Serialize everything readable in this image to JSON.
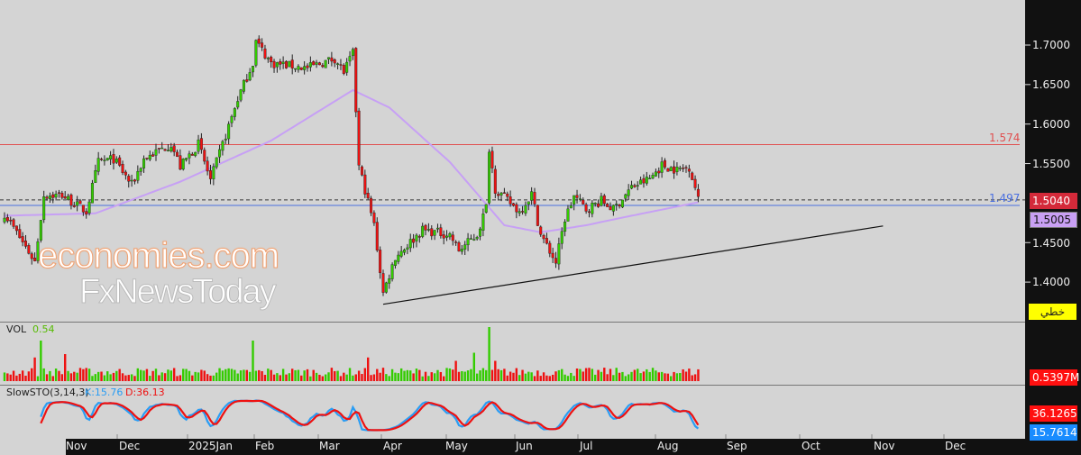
{
  "chart_data": {
    "type": "candlestick",
    "symbol_note": "daily price chart",
    "price_axis": {
      "ticks": [
        "1.7000",
        "1.6500",
        "1.6000",
        "1.5500",
        "1.4500",
        "1.4000"
      ],
      "ylim": [
        1.355,
        1.757
      ]
    },
    "x_axis": {
      "labels": [
        "Nov",
        "Dec",
        "2025Jan",
        "Feb",
        "Mar",
        "Apr",
        "May",
        "Jun",
        "Jul",
        "Aug",
        "Sep",
        "Oct",
        "Nov",
        "Dec"
      ]
    },
    "candle_count": 230,
    "close_keypoints": [
      [
        0,
        1.487
      ],
      [
        10,
        1.426
      ],
      [
        13,
        1.51
      ],
      [
        19,
        1.51
      ],
      [
        27,
        1.489
      ],
      [
        31,
        1.552
      ],
      [
        36,
        1.556
      ],
      [
        42,
        1.523
      ],
      [
        46,
        1.556
      ],
      [
        55,
        1.575
      ],
      [
        58,
        1.546
      ],
      [
        64,
        1.575
      ],
      [
        68,
        1.529
      ],
      [
        73,
        1.586
      ],
      [
        77,
        1.632
      ],
      [
        82,
        1.678
      ],
      [
        83,
        1.705
      ],
      [
        88,
        1.677
      ],
      [
        100,
        1.671
      ],
      [
        109,
        1.683
      ],
      [
        112,
        1.666
      ],
      [
        115,
        1.689
      ],
      [
        117,
        1.546
      ],
      [
        119,
        1.517
      ],
      [
        122,
        1.472
      ],
      [
        125,
        1.386
      ],
      [
        129,
        1.432
      ],
      [
        138,
        1.466
      ],
      [
        147,
        1.46
      ],
      [
        150,
        1.44
      ],
      [
        156,
        1.46
      ],
      [
        159,
        1.495
      ],
      [
        160,
        1.57
      ],
      [
        162,
        1.518
      ],
      [
        170,
        1.489
      ],
      [
        174,
        1.512
      ],
      [
        177,
        1.46
      ],
      [
        182,
        1.425
      ],
      [
        185,
        1.48
      ],
      [
        188,
        1.509
      ],
      [
        192,
        1.492
      ],
      [
        197,
        1.503
      ],
      [
        201,
        1.492
      ],
      [
        207,
        1.52
      ],
      [
        213,
        1.531
      ],
      [
        217,
        1.548
      ],
      [
        222,
        1.542
      ],
      [
        226,
        1.546
      ],
      [
        228,
        1.52
      ],
      [
        229,
        1.504
      ]
    ],
    "ma_keypoints": [
      [
        0,
        1.484
      ],
      [
        30,
        1.487
      ],
      [
        58,
        1.527
      ],
      [
        88,
        1.579
      ],
      [
        115,
        1.643
      ],
      [
        127,
        1.621
      ],
      [
        147,
        1.552
      ],
      [
        165,
        1.472
      ],
      [
        177,
        1.463
      ],
      [
        192,
        1.472
      ],
      [
        207,
        1.484
      ],
      [
        229,
        1.501
      ]
    ],
    "trendline": {
      "from": [
        125,
        1.372
      ],
      "to": [
        290,
        1.471
      ]
    },
    "levels": [
      {
        "value": "1.574",
        "color": "#e05050"
      },
      {
        "value": "1.497",
        "color": "#4a6fe0"
      }
    ],
    "last_price": "1.5040",
    "ma_value": "1.5005",
    "chart_type_label": "خطي",
    "volume": {
      "label": "VOL",
      "value": "0.54",
      "last": "0.5397M",
      "spikes": [
        [
          10,
          3.5
        ],
        [
          12,
          6
        ],
        [
          20,
          4
        ],
        [
          82,
          6
        ],
        [
          160,
          8
        ],
        [
          149,
          3
        ],
        [
          155,
          4.2
        ],
        [
          162,
          3
        ],
        [
          120,
          3.5
        ]
      ]
    },
    "stochastic": {
      "label": "SlowSTO(3,14,3)",
      "k_label": "K:15.76",
      "d_label": "D:36.13",
      "k_value": "15.7614",
      "d_value": "36.1265",
      "k_period": 14,
      "smooth": 3,
      "d_period": 3
    },
    "watermark": {
      "line1": "economies.com",
      "line2": "FxNewsToday"
    },
    "colors": {
      "up": "#33cc00",
      "down": "#ee1111",
      "ma": "#c7a0f5",
      "k": "#2a9df4",
      "d": "#ee1111"
    }
  }
}
